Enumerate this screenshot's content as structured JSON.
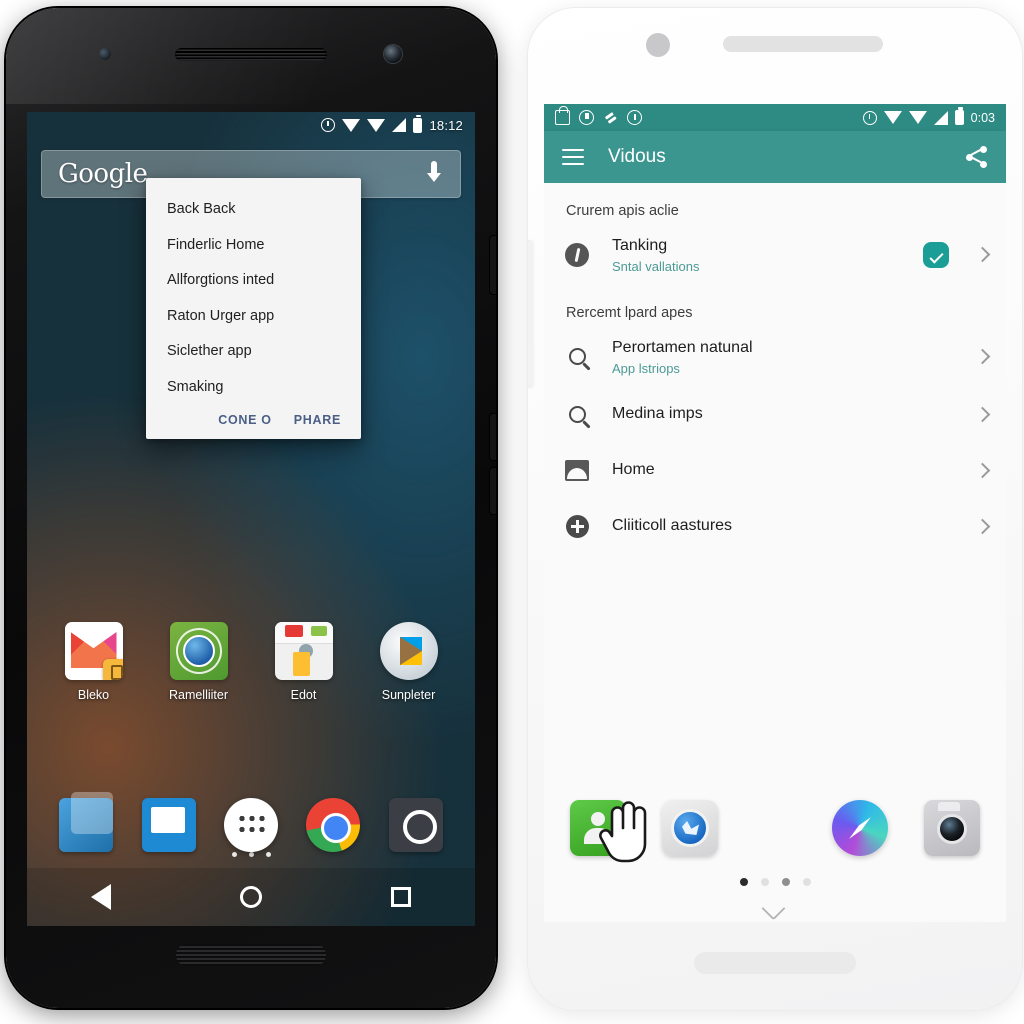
{
  "dark_phone": {
    "status_bar": {
      "time": "18:12",
      "icons": [
        "alarm-icon",
        "wifi-icon",
        "wifi-icon",
        "signal-icon",
        "battery-icon"
      ]
    },
    "search_widget": {
      "logo": "Google",
      "mic_icon": "mic-icon"
    },
    "dialog": {
      "items": [
        "Back Back",
        "Finderlic Home",
        "Allforgtions inted",
        "Raton Urger app",
        "Siclether app",
        "Smaking"
      ],
      "buttons": [
        "CONE O",
        "PHARE"
      ]
    },
    "apps": [
      {
        "label": "Bleko",
        "icon": "gmail-icon"
      },
      {
        "label": "Ramelliiter",
        "icon": "earth-icon"
      },
      {
        "label": "Edot",
        "icon": "toolbox-icon"
      },
      {
        "label": "Sunpleter",
        "icon": "play-store-icon"
      }
    ],
    "page_dots": 3,
    "dock": [
      "files-icon",
      "messages-icon",
      "app-drawer-icon",
      "chrome-icon",
      "camera-icon"
    ],
    "navbar": [
      "back-icon",
      "home-icon",
      "recents-icon"
    ]
  },
  "light_phone": {
    "status_bar": {
      "time": "0:03",
      "left_icons": [
        "lock-icon",
        "download-icon",
        "slash-icon",
        "alert-icon"
      ],
      "right_icons": [
        "alarm-icon",
        "wifi-icon",
        "wifi-icon",
        "signal-icon",
        "battery-icon"
      ]
    },
    "appbar": {
      "menu_icon": "hamburger-icon",
      "title": "Vidous",
      "share_icon": "share-icon"
    },
    "sections": [
      {
        "header": "Crurem apis aclie",
        "rows": [
          {
            "icon": "info-icon",
            "title": "Tanking",
            "subtitle": "Sntal vallations",
            "badge": "check-badge",
            "chevron": true
          }
        ]
      },
      {
        "header": "Rercemt lpard apes",
        "rows": [
          {
            "icon": "search-icon",
            "title": "Perortamen natunal",
            "subtitle": "App lstriops",
            "chevron": true
          },
          {
            "icon": "search-icon",
            "title": "Medina imps",
            "subtitle": "",
            "chevron": true
          },
          {
            "icon": "image-icon",
            "title": "Home",
            "subtitle": "",
            "chevron": true
          },
          {
            "icon": "plus-icon",
            "title": "Cliiticoll aastures",
            "subtitle": "",
            "chevron": true
          }
        ]
      }
    ],
    "dock": [
      "contacts-icon",
      "maps-icon",
      "safari-icon",
      "camera-icon"
    ],
    "page_dots": {
      "count": 4,
      "active_index": 0
    },
    "home_indicator": "chevron-down-icon",
    "cursor": "pointer-hand-cursor"
  },
  "colors": {
    "teal_appbar": "#3b968f",
    "teal_statusbar": "#2e8b84",
    "teal_accent": "#1a9e95",
    "subtitle_teal": "#4b9a95",
    "dialog_bg": "#f4f4f4",
    "dialog_button": "#4a5f86",
    "light_screen_bg": "#fafafa"
  }
}
